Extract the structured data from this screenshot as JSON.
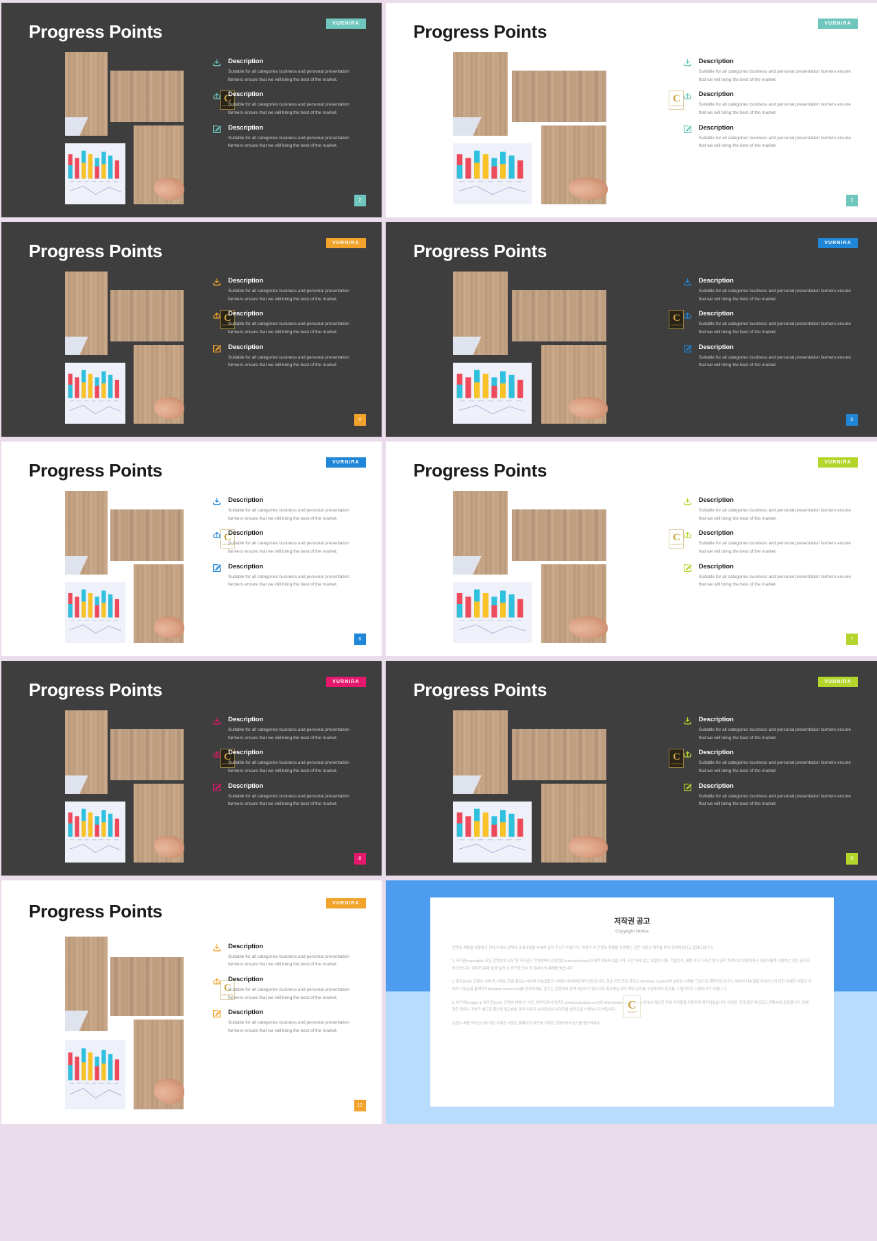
{
  "page": {
    "background_color": "#eadcea",
    "brand_label": "VURNIRA"
  },
  "icons": {
    "download": "download-icon",
    "share": "share-upload-icon",
    "edit": "edit-pencil-icon"
  },
  "common": {
    "title": "Progress Points",
    "desc_heading": "Description",
    "desc_text": "Suitable for all categories business and personal presentation farmers ensure that we will bring the best of the market.",
    "logo_letter": "C",
    "logo_caption": "CONTENTS"
  },
  "slides": [
    {
      "id": "slide-2",
      "title": "Progress Points",
      "brand": "VURNIRA",
      "page_number": "2",
      "theme": "dark",
      "accent": "#6ec6bd",
      "items": [
        {
          "icon": "download-icon",
          "heading": "Description",
          "text": "Suitable for all categories business and personal presentation farmers ensure that we will bring the best of the market."
        },
        {
          "icon": "share-upload-icon",
          "heading": "Description",
          "text": "Suitable for all categories business and personal presentation farmers ensure that we will bring the best of the market."
        },
        {
          "icon": "edit-pencil-icon",
          "heading": "Description",
          "text": "Suitable for all categories business and personal presentation farmers ensure that we will bring the best of the market."
        }
      ]
    },
    {
      "id": "slide-3",
      "title": "Progress Points",
      "brand": "VURNIRA",
      "page_number": "3",
      "theme": "light",
      "accent": "#6ec6bd",
      "items": [
        {
          "icon": "download-icon",
          "heading": "Description",
          "text": "Suitable for all categories business and personal presentation farmers ensure that we will bring the best of the market."
        },
        {
          "icon": "share-upload-icon",
          "heading": "Description",
          "text": "Suitable for all categories business and personal presentation farmers ensure that we will bring the best of the market."
        },
        {
          "icon": "edit-pencil-icon",
          "heading": "Description",
          "text": "Suitable for all categories business and personal presentation farmers ensure that we will bring the best of the market."
        }
      ]
    },
    {
      "id": "slide-4",
      "title": "Progress Points",
      "brand": "VURNIRA",
      "page_number": "4",
      "theme": "dark",
      "accent": "#f2a32b",
      "items": [
        {
          "icon": "download-icon",
          "heading": "Description",
          "text": "Suitable for all categories business and personal presentation farmers ensure that we will bring the best of the market."
        },
        {
          "icon": "share-upload-icon",
          "heading": "Description",
          "text": "Suitable for all categories business and personal presentation farmers ensure that we will bring the best of the market."
        },
        {
          "icon": "edit-pencil-icon",
          "heading": "Description",
          "text": "Suitable for all categories business and personal presentation farmers ensure that we will bring the best of the market."
        }
      ]
    },
    {
      "id": "slide-5",
      "title": "Progress Points",
      "brand": "VURNIRA",
      "page_number": "5",
      "theme": "dark",
      "accent": "#1f86d8",
      "items": [
        {
          "icon": "download-icon",
          "heading": "Description",
          "text": "Suitable for all categories business and personal presentation farmers ensure that we will bring the best of the market."
        },
        {
          "icon": "share-upload-icon",
          "heading": "Description",
          "text": "Suitable for all categories business and personal presentation farmers ensure that we will bring the best of the market."
        },
        {
          "icon": "edit-pencil-icon",
          "heading": "Description",
          "text": "Suitable for all categories business and personal presentation farmers ensure that we will bring the best of the market."
        }
      ]
    },
    {
      "id": "slide-6",
      "title": "Progress Points",
      "brand": "VURNIRA",
      "page_number": "6",
      "theme": "light",
      "accent": "#1f86d8",
      "items": [
        {
          "icon": "download-icon",
          "heading": "Description",
          "text": "Suitable for all categories business and personal presentation farmers ensure that we will bring the best of the market."
        },
        {
          "icon": "share-upload-icon",
          "heading": "Description",
          "text": "Suitable for all categories business and personal presentation farmers ensure that we will bring the best of the market."
        },
        {
          "icon": "edit-pencil-icon",
          "heading": "Description",
          "text": "Suitable for all categories business and personal presentation farmers ensure that we will bring the best of the market."
        }
      ]
    },
    {
      "id": "slide-7",
      "title": "Progress Points",
      "brand": "VURNIRA",
      "page_number": "7",
      "theme": "light",
      "accent": "#b4d62c",
      "items": [
        {
          "icon": "download-icon",
          "heading": "Description",
          "text": "Suitable for all categories business and personal presentation farmers ensure that we will bring the best of the market."
        },
        {
          "icon": "share-upload-icon",
          "heading": "Description",
          "text": "Suitable for all categories business and personal presentation farmers ensure that we will bring the best of the market."
        },
        {
          "icon": "edit-pencil-icon",
          "heading": "Description",
          "text": "Suitable for all categories business and personal presentation farmers ensure that we will bring the best of the market."
        }
      ]
    },
    {
      "id": "slide-8",
      "title": "Progress Points",
      "brand": "VURNIRA",
      "page_number": "8",
      "theme": "dark",
      "accent": "#e5186d",
      "items": [
        {
          "icon": "download-icon",
          "heading": "Description",
          "text": "Suitable for all categories business and personal presentation farmers ensure that we will bring the best of the market."
        },
        {
          "icon": "share-upload-icon",
          "heading": "Description",
          "text": "Suitable for all categories business and personal presentation farmers ensure that we will bring the best of the market."
        },
        {
          "icon": "edit-pencil-icon",
          "heading": "Description",
          "text": "Suitable for all categories business and personal presentation farmers ensure that we will bring the best of the market."
        }
      ]
    },
    {
      "id": "slide-9",
      "title": "Progress Points",
      "brand": "VURNIRA",
      "page_number": "9",
      "theme": "dark",
      "accent": "#b4d62c",
      "items": [
        {
          "icon": "download-icon",
          "heading": "Description",
          "text": "Suitable for all categories business and personal presentation farmers ensure that we will bring the best of the market."
        },
        {
          "icon": "share-upload-icon",
          "heading": "Description",
          "text": "Suitable for all categories business and personal presentation farmers ensure that we will bring the best of the market."
        },
        {
          "icon": "edit-pencil-icon",
          "heading": "Description",
          "text": "Suitable for all categories business and personal presentation farmers ensure that we will bring the best of the market."
        }
      ]
    },
    {
      "id": "slide-10",
      "title": "Progress Points",
      "brand": "VURNIRA",
      "page_number": "10",
      "theme": "light",
      "accent": "#f2a32b",
      "items": [
        {
          "icon": "download-icon",
          "heading": "Description",
          "text": "Suitable for all categories business and personal presentation farmers ensure that we will bring the best of the market."
        },
        {
          "icon": "share-upload-icon",
          "heading": "Description",
          "text": "Suitable for all categories business and personal presentation farmers ensure that we will bring the best of the market."
        },
        {
          "icon": "edit-pencil-icon",
          "heading": "Description",
          "text": "Suitable for all categories business and personal presentation farmers ensure that we will bring the best of the market."
        }
      ]
    }
  ],
  "copyright_slide": {
    "id": "slide-copyright",
    "border_color": "#4d9cf0",
    "band_color": "#b8dcfb",
    "title": "저작권 공고",
    "subtitle": "Copyright Notice",
    "watermark_letter": "C",
    "watermark_caption": "CONTENTS",
    "paragraphs": [
      "콘텐츠 제품을 사용하기 전에 아래의 항목과 소개내용을 사세히 읽어 주시기 바랍니다. 귀하가 이 콘텐츠 제품을 사용하는 것은 사용시 계약을 받아 동의하셨다고 알려드립니다.",
      "1. 저작권(copyright): 모든 콘텐츠의 소유 및 저작권은 콘텐츠바이스닷컴(Contentstokeory)의 제작자에게 있습니다. 사진 속에 있는 모델의 이름, 기업인식, 제품 사진 디자인 등의 권리 목적으로 이용하셔서 제삼자에게 이용하는 것은 금지되어 있습니다. 이러한 문제 발생 발견 시 중단한 민사 및 형사상의 제재를 받습니다.",
      "2. 폰트(font): 콘텐츠 내에 편 서체는 한글 폰트는 네이버 나눔글꼴의 서체로 네이버에 저작권있습니다. 한글 외의 모든 폰트는 Windows System에 설치된 서체를 그냥으로 제작되었습니다. 네이버 나눔글꼴 라이선스에 대한 자세한 사항은 네이버 나눔글꼴 홈페이지(hangeul.naver.com)를 참조하세요. 폰트는 콘텐츠와 함께 제공되지 않으므로 필요하실 경우 해당 폰트를 구입하셔서 폰트를 그 법적으로 사용하시기 바랍니다.",
      "3. 이미지(image) & 아이콘(icon): 콘텐츠 내에 된 사진, 이미지와 아이콘은 pixabay(pixabay.com)와 Webolyst(webolys.com) 등에서 제공한 무료 저작물을 이용하여 제작되었습니다. 아이콘, 폰트로만 제공되고 콘텐츠에 포함합니다. 이에 관한 권리는 귀하가 별도로 확인이 필요하실 경우 이미지 사이트에서 이미지를 법적으로 사용하시기 바랍니다.",
      "콘텐츠 제품 라이선스에 대한 자세한 사항은 홈페이지 하단에 기재한 콘텐츠라이선스를 참조하세요."
    ]
  }
}
